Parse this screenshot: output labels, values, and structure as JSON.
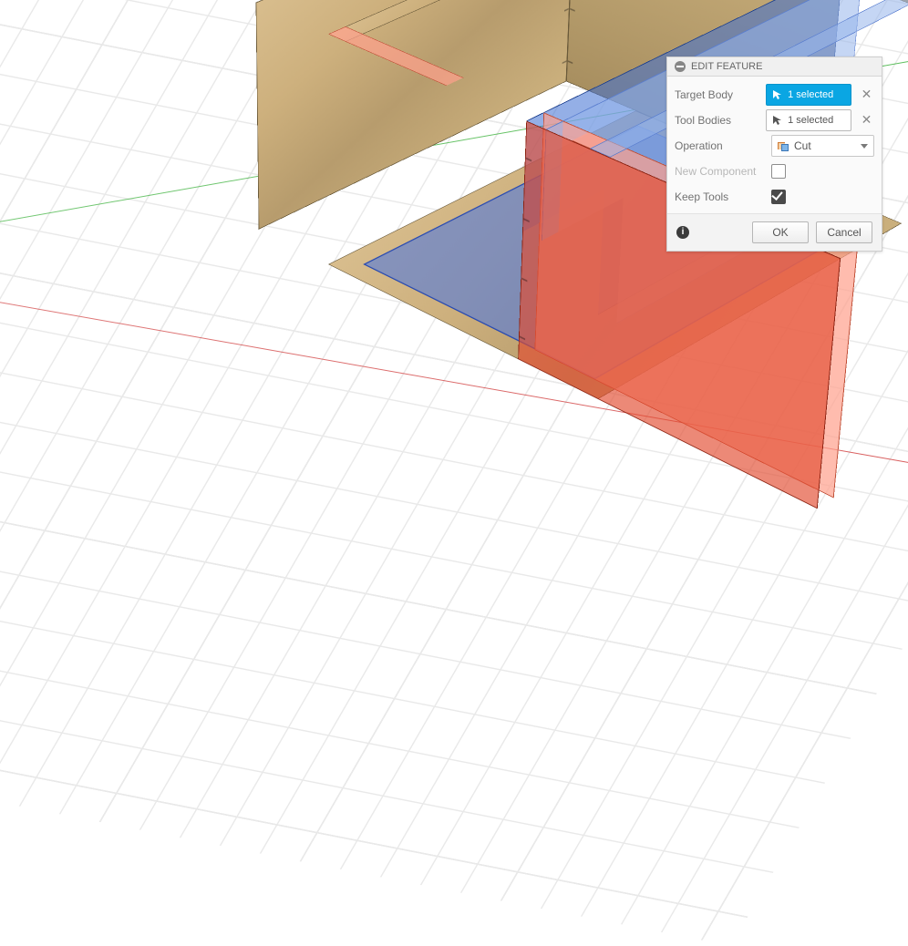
{
  "panel": {
    "title": "EDIT FEATURE",
    "rows": {
      "target_body": {
        "label": "Target Body",
        "chip_text": "1 selected",
        "active": true
      },
      "tool_bodies": {
        "label": "Tool Bodies",
        "chip_text": "1 selected",
        "active": false
      },
      "operation": {
        "label": "Operation",
        "value": "Cut"
      },
      "new_component": {
        "label": "New Component",
        "checked": false,
        "disabled": true
      },
      "keep_tools": {
        "label": "Keep Tools",
        "checked": true
      }
    },
    "buttons": {
      "ok": "OK",
      "cancel": "Cancel"
    }
  }
}
